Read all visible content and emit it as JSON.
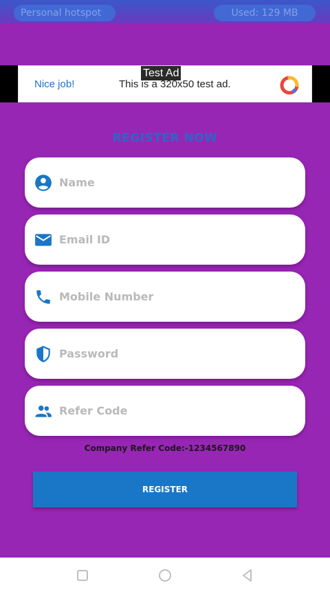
{
  "status_bar": {
    "left_pill": "Personal hotspot",
    "right_pill": "Used: 129 MB"
  },
  "ad": {
    "label": "Test Ad",
    "nice": "Nice job!",
    "text": "This is a 320x50 test ad."
  },
  "title": "REGISTER NOW",
  "fields": {
    "name": "Name",
    "email": "Email ID",
    "mobile": "Mobile Number",
    "password": "Password",
    "refer": "Refer Code"
  },
  "refer_note": "Company Refer Code:-1234567890",
  "register_label": "REGISTER",
  "colors": {
    "background": "#9826b4",
    "accent": "#1a76c7",
    "title": "#2f65c7"
  }
}
